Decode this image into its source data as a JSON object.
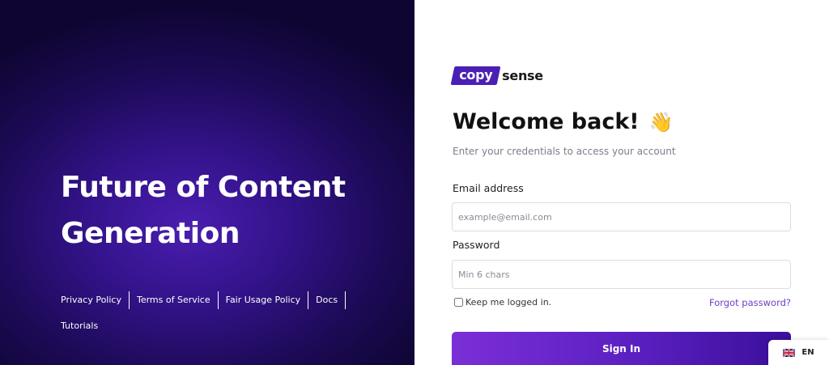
{
  "hero": {
    "title": "Future of Content Generation",
    "links": [
      "Privacy Policy",
      "Terms of Service",
      "Fair Usage Policy",
      "Docs",
      "Tutorials"
    ]
  },
  "logo": {
    "badge": "copy",
    "text": "sense"
  },
  "form": {
    "heading": "Welcome back!",
    "wave_emoji": "👋",
    "subtitle": "Enter your credentials to access your account",
    "email_label": "Email address",
    "email_placeholder": "example@email.com",
    "password_label": "Password",
    "password_placeholder": "Min 6 chars",
    "remember_label": "Keep me logged in.",
    "forgot_label": "Forgot password?",
    "signin_label": "Sign In"
  },
  "language": {
    "code": "EN",
    "flag_icon": "uk-flag-icon"
  },
  "colors": {
    "brand": "#4b1fb5",
    "accent_link": "#6c3fc9",
    "panel_dark": "#1c0a55"
  }
}
